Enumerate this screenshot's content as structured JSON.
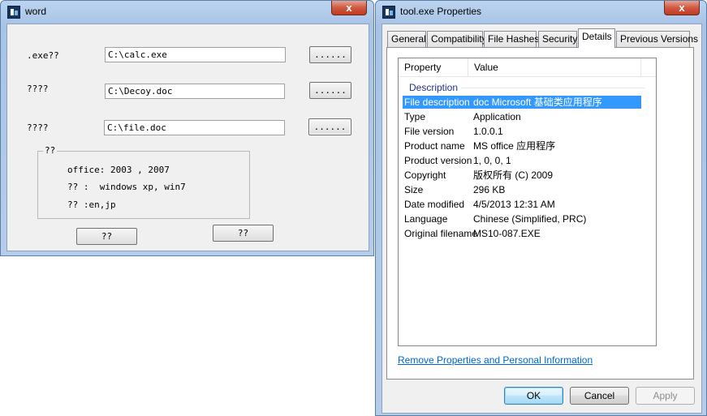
{
  "word_window": {
    "title": "word",
    "close_glyph": "x",
    "rows": [
      {
        "label": ".exe??",
        "value": "C:\\calc.exe",
        "browse": "......"
      },
      {
        "label": "????",
        "value": "C:\\Decoy.doc",
        "browse": "......"
      },
      {
        "label": "????",
        "value": "C:\\file.doc",
        "browse": "......"
      }
    ],
    "group": {
      "legend": "??",
      "line1": "office: 2003 , 2007",
      "line2": "?? :  windows xp, win7",
      "line3": "?? :en,jp"
    },
    "button1": "??",
    "button2": "??"
  },
  "props_window": {
    "title": "tool.exe Properties",
    "close_glyph": "x",
    "tabs": [
      "General",
      "Compatibility",
      "File Hashes",
      "Security",
      "Details",
      "Previous Versions"
    ],
    "active_tab": "Details",
    "columns": {
      "property": "Property",
      "value": "Value"
    },
    "section": "Description",
    "rows": [
      {
        "property": "File description",
        "value": "doc Microsoft 基础类应用程序",
        "selected": true
      },
      {
        "property": "Type",
        "value": "Application"
      },
      {
        "property": "File version",
        "value": "1.0.0.1"
      },
      {
        "property": "Product name",
        "value": "MS office 应用程序"
      },
      {
        "property": "Product version",
        "value": "1, 0, 0, 1"
      },
      {
        "property": "Copyright",
        "value": "版权所有 (C) 2009"
      },
      {
        "property": "Size",
        "value": "296 KB"
      },
      {
        "property": "Date modified",
        "value": "4/5/2013 12:31 AM"
      },
      {
        "property": "Language",
        "value": "Chinese (Simplified, PRC)"
      },
      {
        "property": "Original filename",
        "value": "MS10-087.EXE"
      }
    ],
    "remove_link": "Remove Properties and Personal Information",
    "ok": "OK",
    "cancel": "Cancel",
    "apply": "Apply"
  }
}
